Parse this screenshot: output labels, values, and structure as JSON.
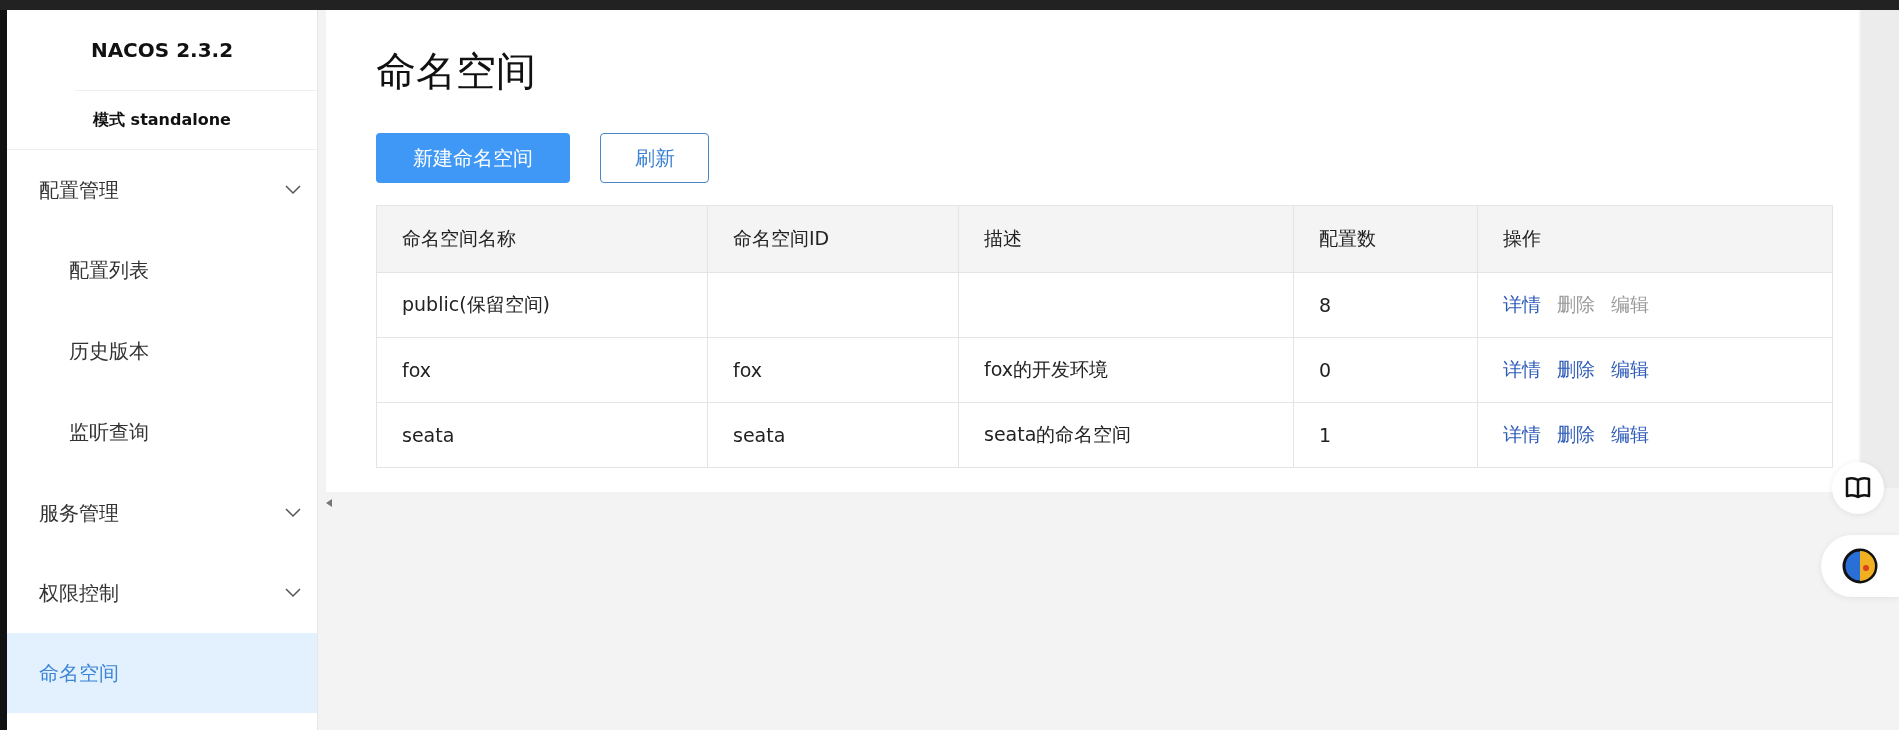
{
  "sidebar": {
    "title": "NACOS 2.3.2",
    "mode": "模式 standalone",
    "items": [
      {
        "kind": "group",
        "label": "配置管理",
        "selected": false,
        "children": [
          {
            "label": "配置列表",
            "selected": false
          },
          {
            "label": "历史版本",
            "selected": false
          },
          {
            "label": "监听查询",
            "selected": false
          }
        ]
      },
      {
        "kind": "group",
        "label": "服务管理",
        "selected": false
      },
      {
        "kind": "group",
        "label": "权限控制",
        "selected": false
      },
      {
        "kind": "link",
        "label": "命名空间",
        "selected": true
      }
    ]
  },
  "page": {
    "title": "命名空间",
    "buttons": [
      {
        "label": "新建命名空间",
        "kind": "primary"
      },
      {
        "label": "刷新",
        "kind": "normal"
      }
    ]
  },
  "table": {
    "columns": [
      "命名空间名称",
      "命名空间ID",
      "描述",
      "配置数",
      "操作"
    ],
    "rows": [
      {
        "cells": [
          "public(保留空间)",
          "",
          "",
          "8"
        ],
        "actions": [
          {
            "label": "详情",
            "disabled": false
          },
          {
            "label": "删除",
            "disabled": true
          },
          {
            "label": "编辑",
            "disabled": true
          }
        ]
      },
      {
        "cells": [
          "fox",
          "fox",
          "fox的开发环境",
          "0"
        ],
        "actions": [
          {
            "label": "详情",
            "disabled": false
          },
          {
            "label": "删除",
            "disabled": false
          },
          {
            "label": "编辑",
            "disabled": false
          }
        ]
      },
      {
        "cells": [
          "seata",
          "seata",
          "seata的命名空间",
          "1"
        ],
        "actions": [
          {
            "label": "详情",
            "disabled": false
          },
          {
            "label": "删除",
            "disabled": false
          },
          {
            "label": "编辑",
            "disabled": false
          }
        ]
      }
    ]
  }
}
